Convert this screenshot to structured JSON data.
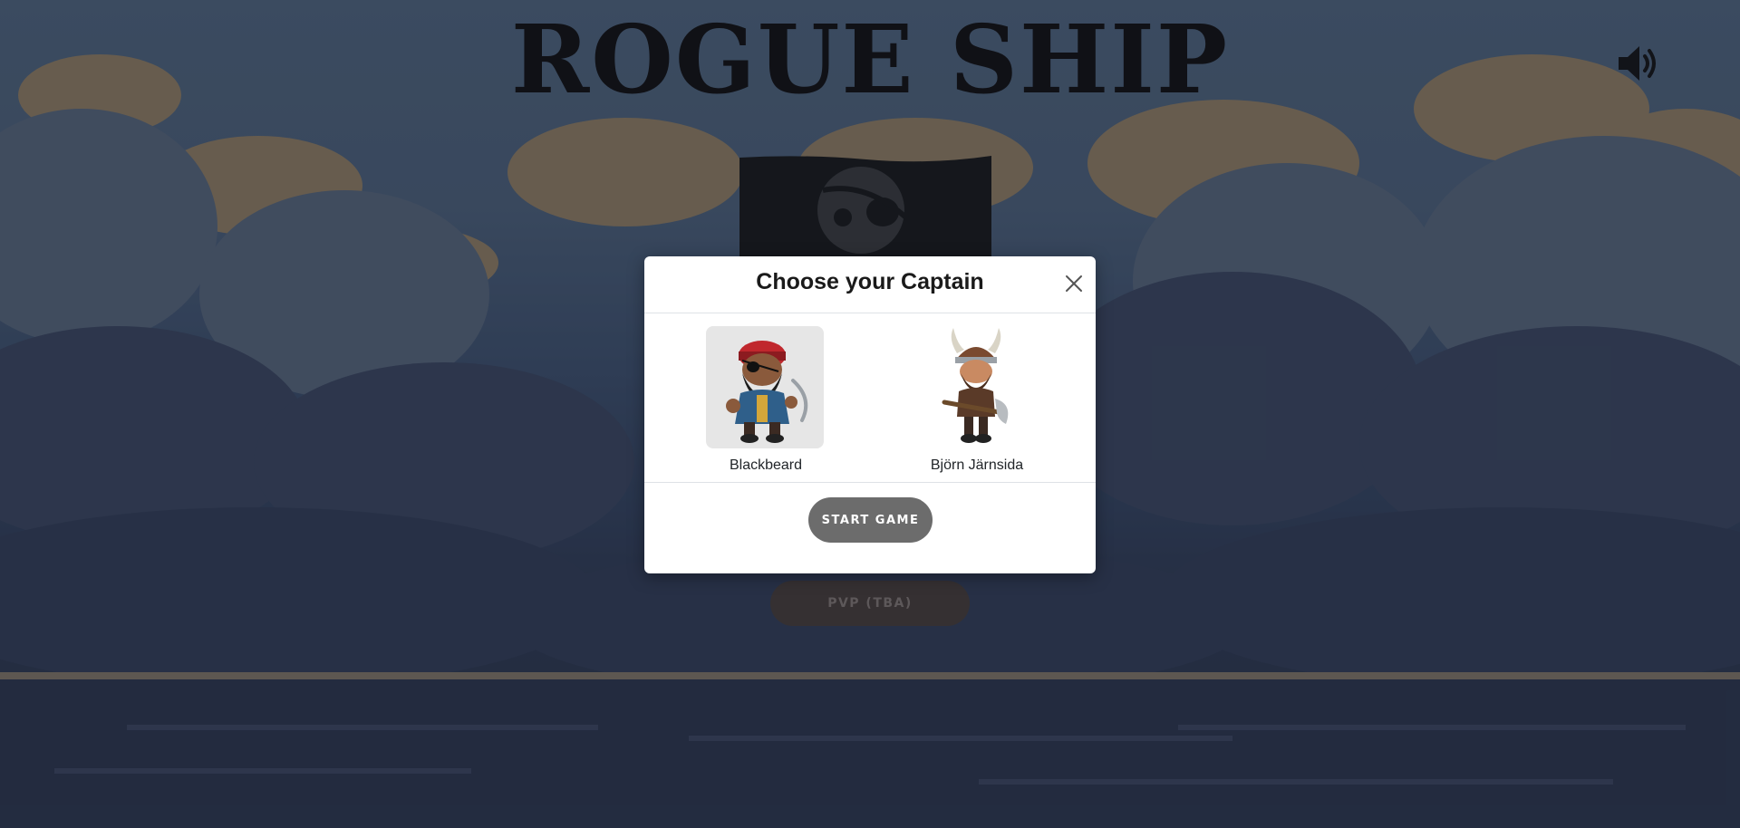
{
  "game": {
    "title": "ROGUE SHIP"
  },
  "icons": {
    "sound": "volume-icon",
    "flag": "jolly-roger-icon",
    "close": "close-icon"
  },
  "menu": {
    "pvp_label": "PVP (TBA)"
  },
  "modal": {
    "title": "Choose your Captain",
    "captains": [
      {
        "name": "Blackbeard",
        "selected": true
      },
      {
        "name": "Björn Järnsida",
        "selected": false
      }
    ],
    "start_label": "START GAME"
  },
  "colors": {
    "modal_background": "#ffffff",
    "selected_captain_background": "#e6e6e6",
    "start_button": "#6c6c6c",
    "pvp_button": "#4a3f3c",
    "title_text": "#0d0e10"
  }
}
